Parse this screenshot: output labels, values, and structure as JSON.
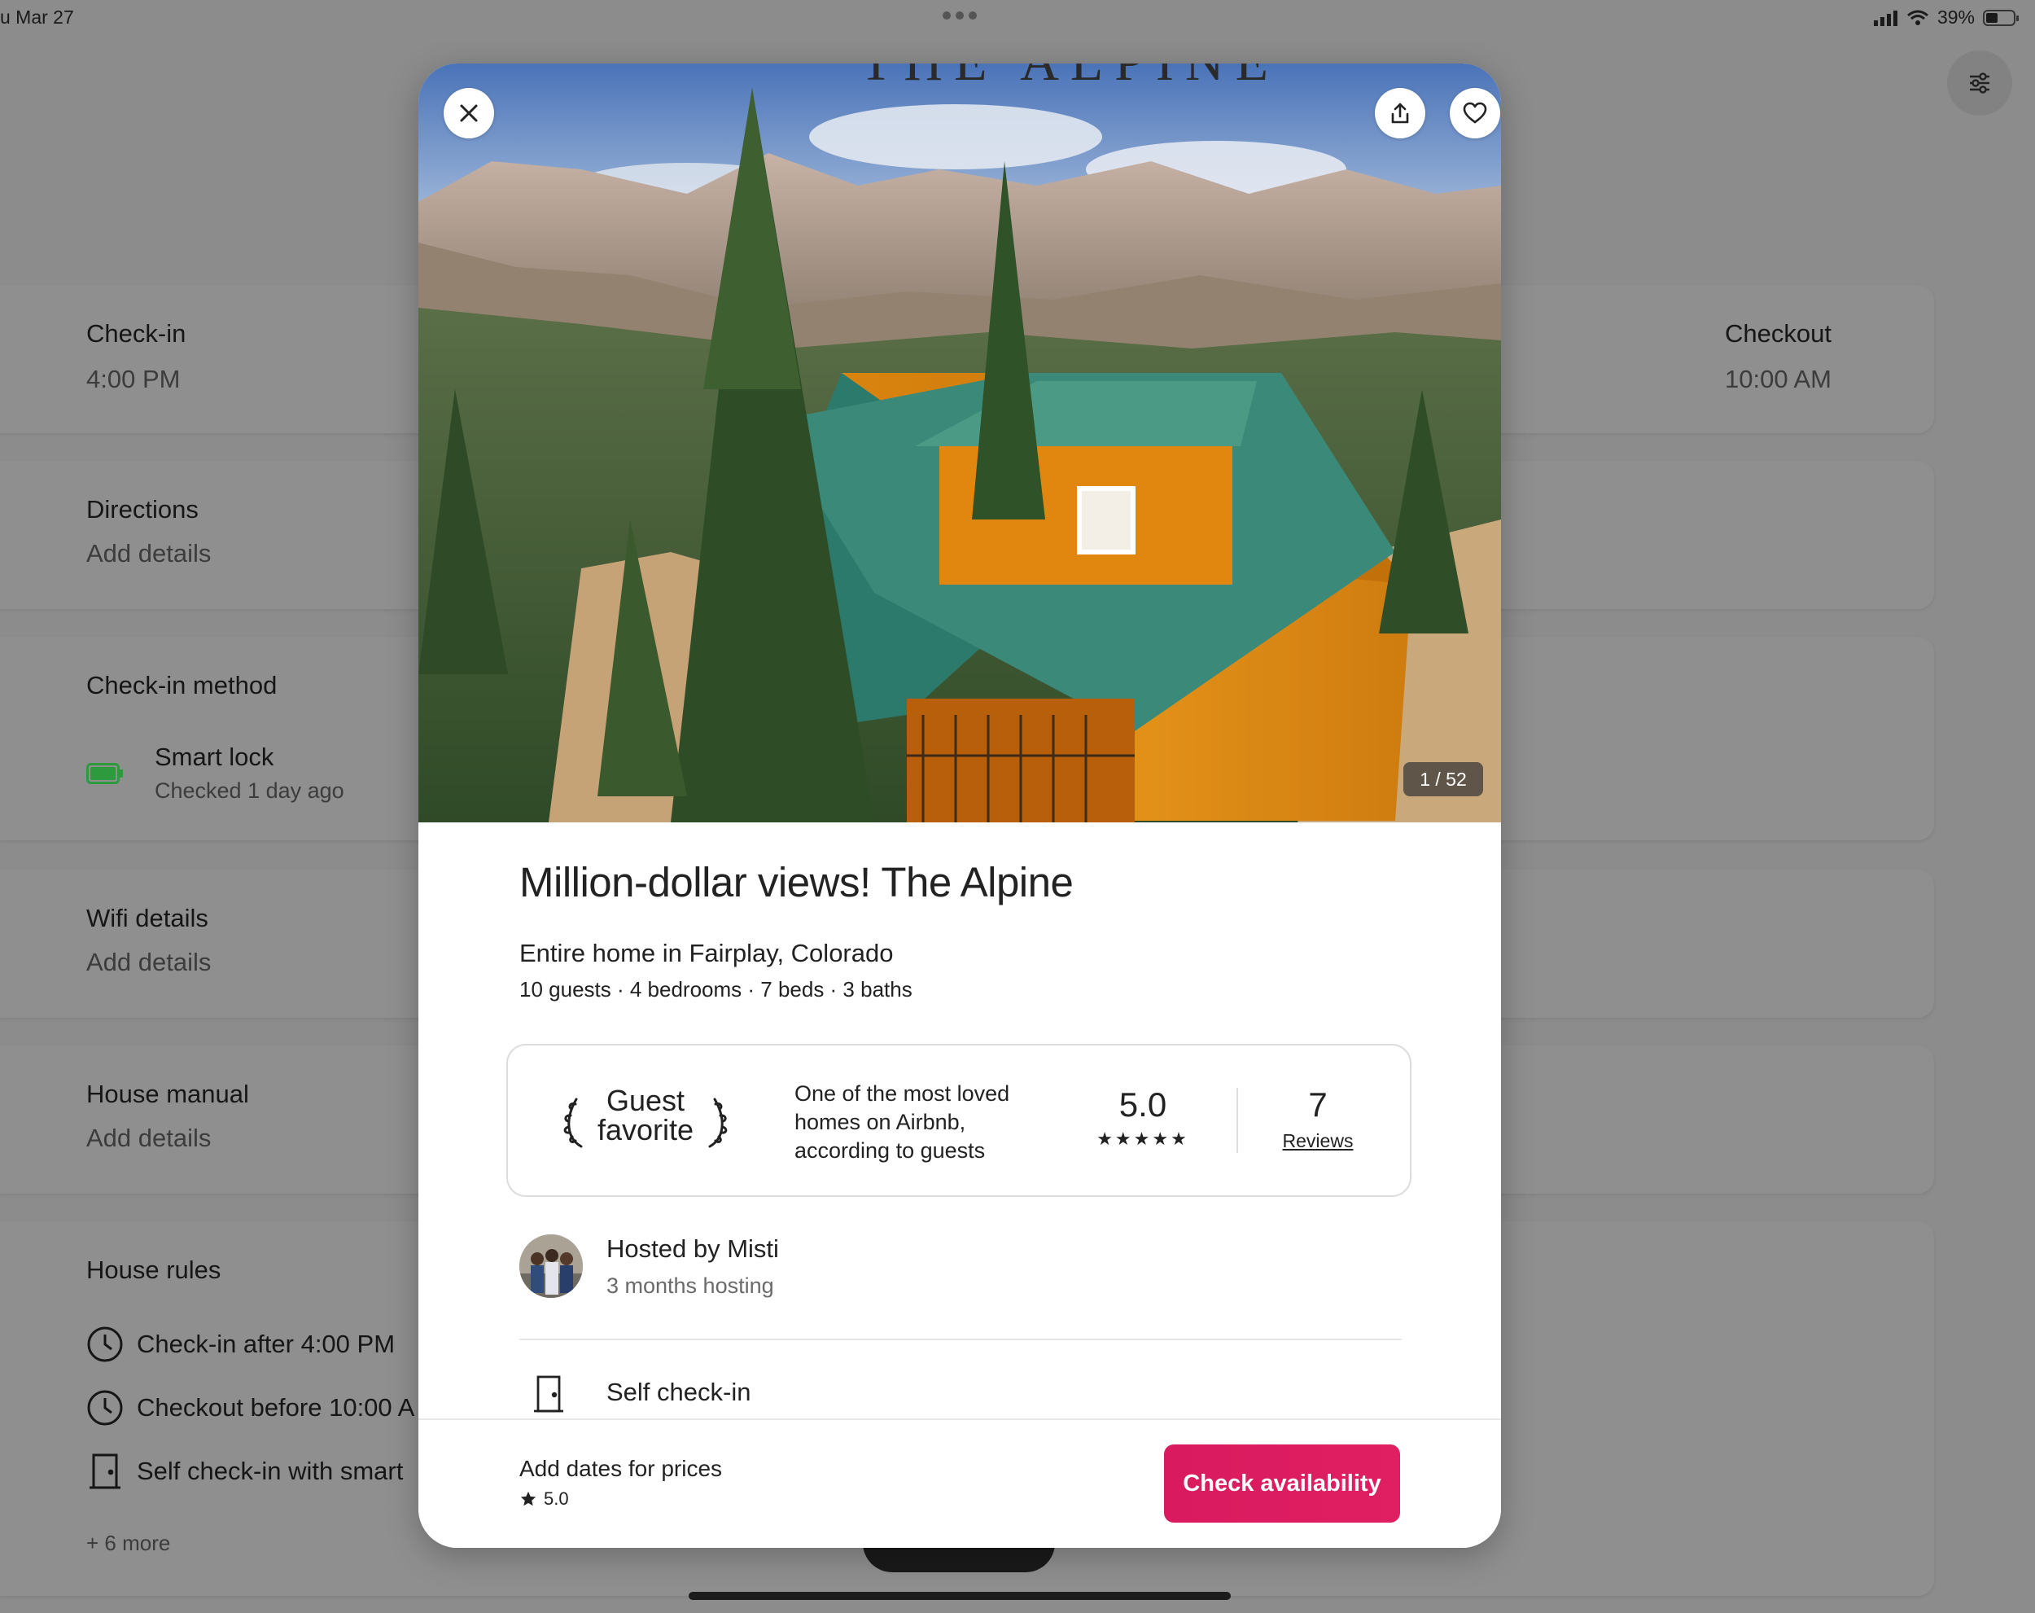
{
  "status_bar": {
    "date": "u Mar 27",
    "battery": "39%",
    "battery_level": 0.39
  },
  "background": {
    "check_in": {
      "title": "Check-in",
      "time": "4:00 PM"
    },
    "checkout": {
      "title": "Checkout",
      "time": "10:00 AM"
    },
    "directions": {
      "title": "Directions",
      "value": "Add details"
    },
    "check_in_method": {
      "title": "Check-in method",
      "method": "Smart lock",
      "status": "Checked 1 day ago"
    },
    "wifi": {
      "title": "Wifi details",
      "value": "Add details"
    },
    "house_manual": {
      "title": "House manual",
      "value": "Add details"
    },
    "house_rules": {
      "title": "House rules",
      "items": [
        "Check-in after 4:00 PM",
        "Checkout before 10:00 A",
        "Self check-in with smart"
      ],
      "more": "+ 6 more"
    }
  },
  "listing": {
    "photo_sign": "THE ALPINE",
    "photo_counter": "1 / 52",
    "title": "Million-dollar views! The Alpine",
    "subtitle": "Entire home in Fairplay, Colorado",
    "meta": "10 guests · 4 bedrooms · 7 beds · 3 baths",
    "guest_favorite": {
      "badge_line1": "Guest",
      "badge_line2": "favorite",
      "description": "One of the most loved homes on Airbnb, according to guests",
      "rating": "5.0",
      "stars": "★★★★★",
      "reviews_count": "7",
      "reviews_label": "Reviews"
    },
    "host": {
      "name": "Hosted by Misti",
      "duration": "3 months hosting"
    },
    "feature": "Self check-in",
    "footer": {
      "prices_text": "Add dates for prices",
      "rating": "5.0",
      "cta": "Check availability"
    }
  },
  "colors": {
    "brand": "#DC1C5F",
    "overlay": "#8C8C8C",
    "battery_green": "#2E9A3E"
  }
}
